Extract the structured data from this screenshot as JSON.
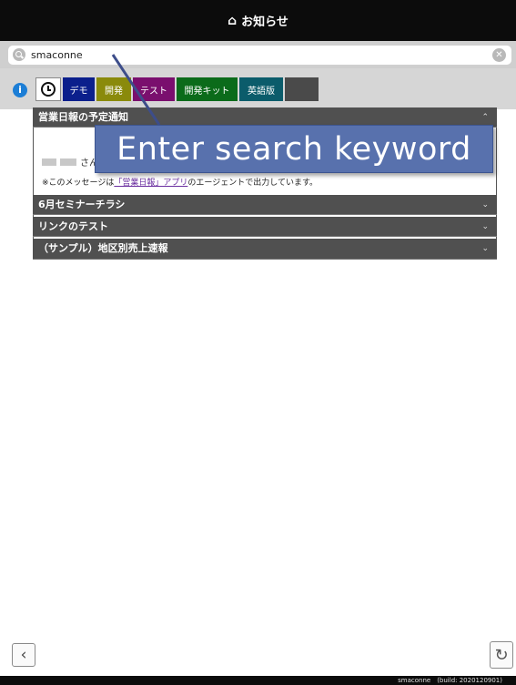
{
  "header": {
    "title": "お知らせ",
    "home_icon": "home-icon"
  },
  "search": {
    "value": "smaconne",
    "clear_icon": "clear-icon"
  },
  "tabs": [
    {
      "label": "デモ",
      "color": "#0b1f8c"
    },
    {
      "label": "開発",
      "color": "#8a8a0b"
    },
    {
      "label": "テスト",
      "color": "#7a0f6e"
    },
    {
      "label": "開発キット",
      "color": "#0b6b1a"
    },
    {
      "label": "英語版",
      "color": "#0b5c6b"
    },
    {
      "label": "",
      "color": "#4a4a4a"
    }
  ],
  "sections": [
    {
      "title": "営業日報の予定通知",
      "expanded": true
    },
    {
      "title": "6月セミナーチラシ"
    },
    {
      "title": "リンクのテスト"
    },
    {
      "title": "（サンプル）地区別売上速報"
    }
  ],
  "message": {
    "name_suffix": "さん",
    "prefix": "※このメッセージは",
    "link": "「営業日報」アプリ",
    "suffix": "のエージェントで出力しています。"
  },
  "tooltip": {
    "text": "Enter search keyword"
  },
  "footer": {
    "build": "smaconne　(build: 2020120901)"
  },
  "colors": {
    "header_bg": "#0c0c0c",
    "section_bg": "#505050",
    "tooltip_bg": "#5871ad",
    "info_blue": "#1c7ed6"
  }
}
